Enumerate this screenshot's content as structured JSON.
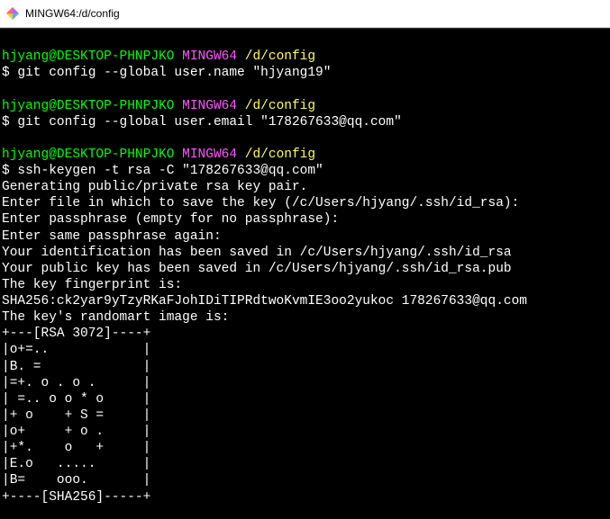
{
  "window": {
    "title": "MINGW64:/d/config"
  },
  "prompt": {
    "user_host": "hjyang@DESKTOP-PHNPJKO",
    "env": "MINGW64",
    "path": "/d/config",
    "symbol": "$"
  },
  "blocks": [
    {
      "command": "git config --global user.name \"hjyang19\"",
      "output": []
    },
    {
      "command": "git config --global user.email \"178267633@qq.com\"",
      "output": []
    },
    {
      "command": "ssh-keygen -t rsa -C \"178267633@qq.com\"",
      "output": [
        "Generating public/private rsa key pair.",
        "Enter file in which to save the key (/c/Users/hjyang/.ssh/id_rsa):",
        "Enter passphrase (empty for no passphrase):",
        "Enter same passphrase again:",
        "Your identification has been saved in /c/Users/hjyang/.ssh/id_rsa",
        "Your public key has been saved in /c/Users/hjyang/.ssh/id_rsa.pub",
        "The key fingerprint is:",
        "SHA256:ck2yar9yTzyRKaFJohIDiTIPRdtwoKvmIE3oo2yukoc 178267633@qq.com",
        "The key's randomart image is:",
        "+---[RSA 3072]----+",
        "|o+=..            |",
        "|B. =             |",
        "|=+. o . o .      |",
        "| =.. o o * o     |",
        "|+ o    + S =     |",
        "|o+     + o .     |",
        "|+*.    o   +     |",
        "|E.o   .....      |",
        "|B=    ooo.       |",
        "+----[SHA256]-----+"
      ]
    }
  ]
}
